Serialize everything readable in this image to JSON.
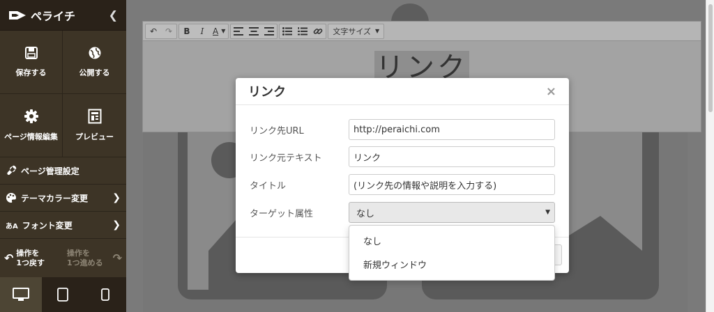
{
  "app": {
    "name": "ペライチ"
  },
  "sidebar": {
    "collapse_icon": "chevron-left-icon",
    "tiles": [
      {
        "label": "保存する",
        "icon": "save-icon"
      },
      {
        "label": "公開する",
        "icon": "globe-icon"
      },
      {
        "label": "ページ情報編集",
        "icon": "gear-icon"
      },
      {
        "label": "プレビュー",
        "icon": "preview-icon"
      }
    ],
    "rows": [
      {
        "label": "ページ管理設定",
        "icon": "wrench-icon"
      },
      {
        "label": "テーマカラー変更",
        "icon": "palette-icon"
      },
      {
        "label": "フォント変更",
        "icon": "font-icon",
        "icon_text": "あA"
      }
    ],
    "undo": {
      "line1": "操作を",
      "line2": "1つ戻す"
    },
    "redo": {
      "line1": "操作を",
      "line2": "1つ進める"
    },
    "devices": [
      "desktop-icon",
      "tablet-icon",
      "mobile-icon"
    ]
  },
  "editor": {
    "toolbar": {
      "undo": "↶",
      "redo": "↷",
      "bold": "B",
      "italic": "I",
      "text_color": "A",
      "font_size_label": "文字サイズ"
    },
    "content_text": "リンク"
  },
  "modal": {
    "title": "リンク",
    "close": "×",
    "fields": [
      {
        "label": "リンク先URL",
        "value": "http://peraichi.com"
      },
      {
        "label": "リンク元テキスト",
        "value": "リンク"
      },
      {
        "label": "タイトル",
        "value": "(リンク先の情報や説明を入力する)"
      },
      {
        "label": "ターゲット属性",
        "value": "なし"
      }
    ],
    "dropdown_options": [
      "なし",
      "新規ウィンドウ"
    ]
  },
  "colors": {
    "sidebar_bg": "#3d3426",
    "sidebar_header_bg": "#2a2219",
    "overlay": "#6b6b6b"
  }
}
